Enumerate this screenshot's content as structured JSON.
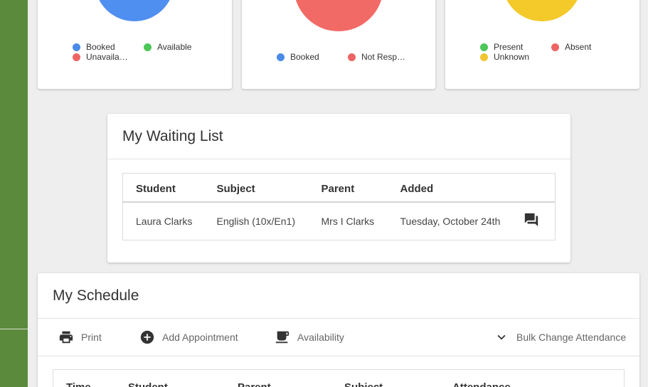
{
  "charts": [
    {
      "pie_color": "#4f8ff0",
      "legend": [
        {
          "label": "Booked",
          "color": "#4a8be8"
        },
        {
          "label": "Available",
          "color": "#4cc758"
        },
        {
          "label": "Unavaila…",
          "color": "#ef6464"
        }
      ]
    },
    {
      "pie_color": "#f26a66",
      "legend": [
        {
          "label": "Booked",
          "color": "#4a8be8"
        },
        {
          "label": "Not Resp…",
          "color": "#ef6464"
        }
      ]
    },
    {
      "pie_color": "#f4c92a",
      "legend": [
        {
          "label": "Present",
          "color": "#4cc758"
        },
        {
          "label": "Absent",
          "color": "#ef6464"
        },
        {
          "label": "Unknown",
          "color": "#f1c532"
        }
      ]
    }
  ],
  "waiting_list": {
    "title": "My Waiting List",
    "columns": [
      "Student",
      "Subject",
      "Parent",
      "Added"
    ],
    "rows": [
      {
        "student": "Laura Clarks",
        "subject": "English (10x/En1)",
        "parent": "Mrs I Clarks",
        "added": "Tuesday, October 24th",
        "action_icon": "chat-icon"
      }
    ]
  },
  "schedule": {
    "title": "My Schedule",
    "toolbar": {
      "print": "Print",
      "add_appointment": "Add Appointment",
      "availability": "Availability",
      "bulk_change": "Bulk Change Attendance"
    },
    "columns": [
      "Time",
      "Student",
      "Parent",
      "Subject",
      "Attendance"
    ]
  }
}
